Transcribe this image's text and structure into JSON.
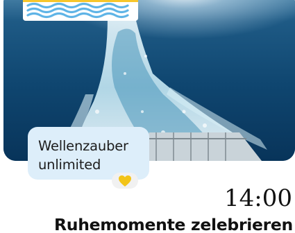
{
  "message": {
    "text": "Wellenzauber unlimited",
    "reaction_icon": "heart-icon",
    "reaction_color": "#f2c418"
  },
  "post": {
    "time": "14:00",
    "title": "Ruhemomente zelebrieren"
  },
  "colors": {
    "bubble_background": "#ddeefa",
    "logo_yellow": "#f7c62c",
    "logo_wave_blue": "#5fb4e6",
    "sea_dark": "#0c3e63"
  }
}
